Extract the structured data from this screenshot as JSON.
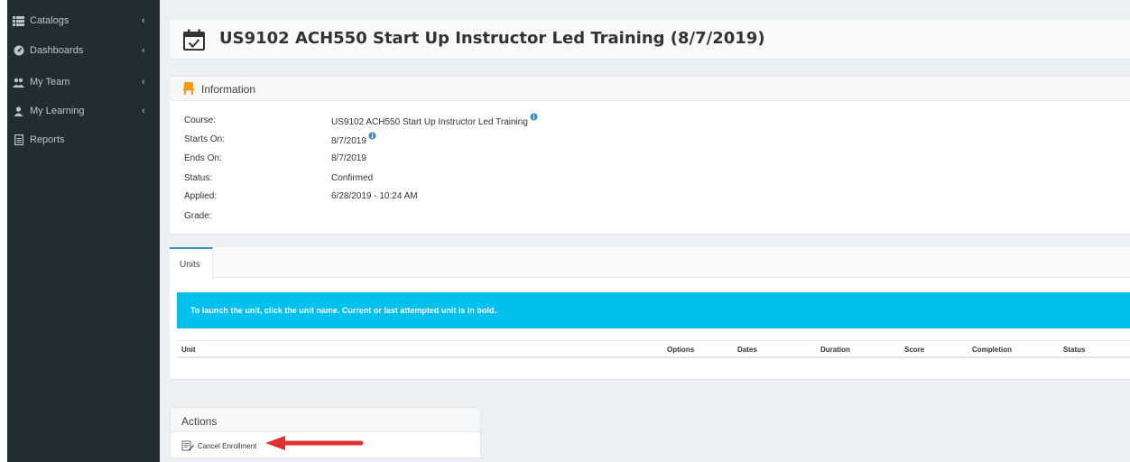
{
  "sidebar": {
    "items": [
      {
        "label": "Catalogs",
        "icon": "list-icon"
      },
      {
        "label": "Dashboards",
        "icon": "dashboard-icon"
      },
      {
        "label": "My Team",
        "icon": "users-icon"
      },
      {
        "label": "My Learning",
        "icon": "user-icon"
      },
      {
        "label": "Reports",
        "icon": "report-icon"
      }
    ]
  },
  "page": {
    "title": "US9102 ACH550 Start Up Instructor Led Training (8/7/2019)"
  },
  "information": {
    "header": "Information",
    "rows": [
      {
        "label": "Course:",
        "value": "US9102 ACH550 Start Up Instructor Led Training"
      },
      {
        "label": "Starts On:",
        "value": "8/7/2019"
      },
      {
        "label": "Ends On:",
        "value": "8/7/2019"
      },
      {
        "label": "Status:",
        "value": "Confirmed"
      },
      {
        "label": "Applied:",
        "value": "6/28/2019 - 10:24 AM"
      },
      {
        "label": "Grade:",
        "value": ""
      }
    ]
  },
  "units": {
    "tab_label": "Units",
    "notice": "To launch the unit, click the unit name. Current or last attempted unit is in bold.",
    "columns": [
      "Unit",
      "Options",
      "Dates",
      "Duration",
      "Score",
      "Completion",
      "Status"
    ]
  },
  "actions": {
    "header": "Actions",
    "cancel_label": "Cancel Enrollment"
  },
  "colors": {
    "sidebar_bg": "#222d32",
    "notice_bg": "#00c0ef",
    "arrow": "#e0302f",
    "tab_accent": "#3c8dbc"
  }
}
